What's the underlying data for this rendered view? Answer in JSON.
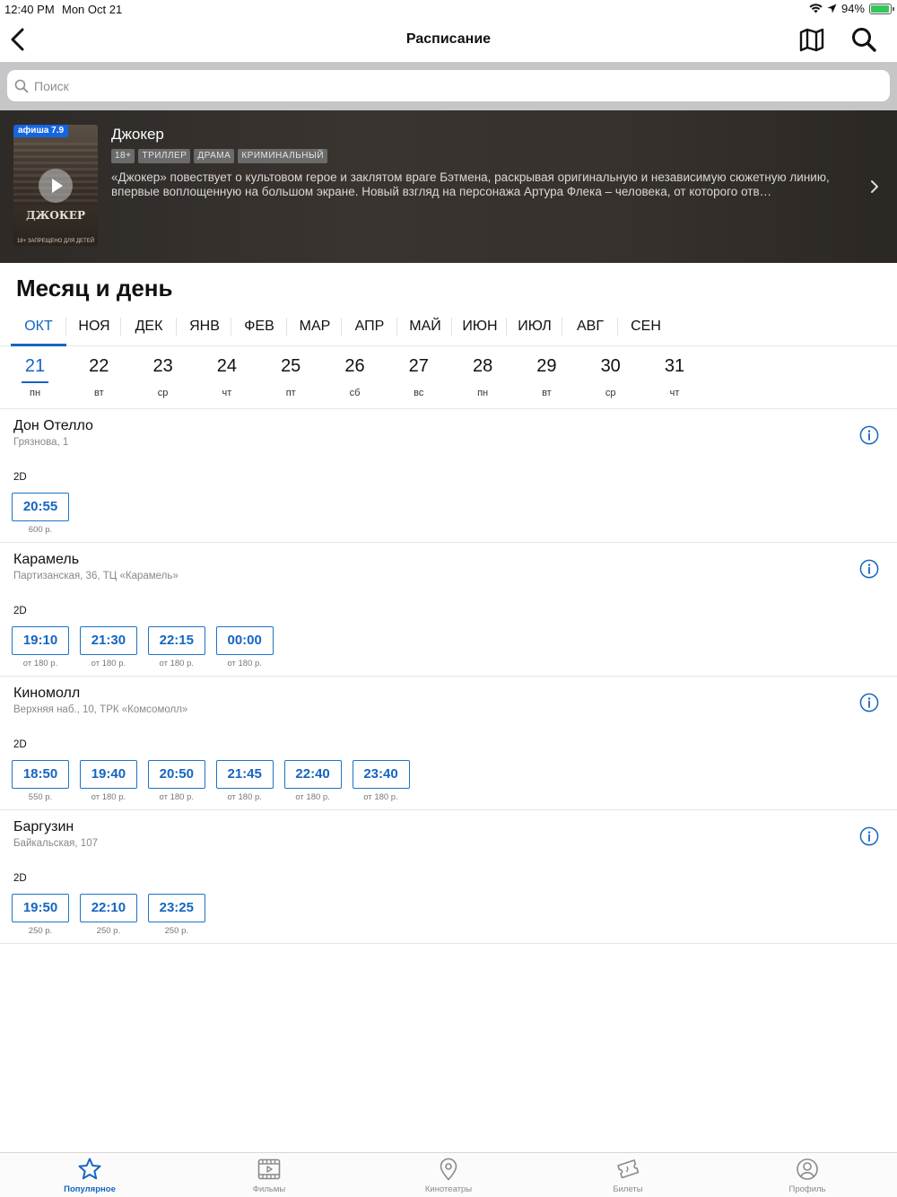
{
  "status": {
    "time": "12:40 PM",
    "date": "Mon Oct 21",
    "battery": "94%",
    "battery_level": 0.94
  },
  "nav": {
    "title": "Расписание",
    "back_icon": "chevron-left-icon",
    "map_icon": "map-icon",
    "search_icon": "search-icon"
  },
  "search": {
    "placeholder": "Поиск",
    "value": ""
  },
  "movie": {
    "badge": "афиша 7.9",
    "poster_title": "ДЖОКЕР",
    "poster_note": "18+ ЗАПРЕЩЕНО ДЛЯ ДЕТЕЙ",
    "title": "Джокер",
    "tags": [
      "18+",
      "ТРИЛЛЕР",
      "ДРАМА",
      "КРИМИНАЛЬНЫЙ"
    ],
    "description": "«Джокер» повествует о культовом герое и заклятом враге Бэтмена, раскрывая оригинальную и независимую сюжетную линию, впервые воплощенную на большом экране. Новый взгляд на персонажа Артура Флека – человека, от которого отв…"
  },
  "section_title": "Месяц и день",
  "months": [
    "ОКТ",
    "НОЯ",
    "ДЕК",
    "ЯНВ",
    "ФЕВ",
    "МАР",
    "АПР",
    "МАЙ",
    "ИЮН",
    "ИЮЛ",
    "АВГ",
    "СЕН"
  ],
  "selected_month": "ОКТ",
  "days": [
    {
      "num": "21",
      "wd": "пн"
    },
    {
      "num": "22",
      "wd": "вт"
    },
    {
      "num": "23",
      "wd": "ср"
    },
    {
      "num": "24",
      "wd": "чт"
    },
    {
      "num": "25",
      "wd": "пт"
    },
    {
      "num": "26",
      "wd": "сб"
    },
    {
      "num": "27",
      "wd": "вс"
    },
    {
      "num": "28",
      "wd": "пн"
    },
    {
      "num": "29",
      "wd": "вт"
    },
    {
      "num": "30",
      "wd": "ср"
    },
    {
      "num": "31",
      "wd": "чт"
    }
  ],
  "selected_day": "21",
  "cinemas": [
    {
      "name": "Дон Отелло",
      "address": "Грязнова, 1",
      "format": "2D",
      "sessions": [
        {
          "time": "20:55",
          "price": "600 р."
        }
      ]
    },
    {
      "name": "Карамель",
      "address": "Партизанская, 36, ТЦ «Карамель»",
      "format": "2D",
      "sessions": [
        {
          "time": "19:10",
          "price": "от 180 р."
        },
        {
          "time": "21:30",
          "price": "от 180 р."
        },
        {
          "time": "22:15",
          "price": "от 180 р."
        },
        {
          "time": "00:00",
          "price": "от 180 р."
        }
      ]
    },
    {
      "name": "Киномолл",
      "address": "Верхняя наб., 10, ТРК «Комсомолл»",
      "format": "2D",
      "sessions": [
        {
          "time": "18:50",
          "price": "550 р."
        },
        {
          "time": "19:40",
          "price": "от 180 р."
        },
        {
          "time": "20:50",
          "price": "от 180 р."
        },
        {
          "time": "21:45",
          "price": "от 180 р."
        },
        {
          "time": "22:40",
          "price": "от 180 р."
        },
        {
          "time": "23:40",
          "price": "от 180 р."
        }
      ]
    },
    {
      "name": "Баргузин",
      "address": "Байкальская, 107",
      "format": "2D",
      "sessions": [
        {
          "time": "19:50",
          "price": "250 р."
        },
        {
          "time": "22:10",
          "price": "250 р."
        },
        {
          "time": "23:25",
          "price": "250 р."
        }
      ]
    }
  ],
  "tabs": [
    {
      "label": "Популярное",
      "icon": "star-icon",
      "active": true
    },
    {
      "label": "Фильмы",
      "icon": "film-icon",
      "active": false
    },
    {
      "label": "Кинотеатры",
      "icon": "location-pin-icon",
      "active": false
    },
    {
      "label": "Билеты",
      "icon": "ticket-icon",
      "active": false
    },
    {
      "label": "Профиль",
      "icon": "profile-icon",
      "active": false
    }
  ],
  "colors": {
    "accent": "#1565c0",
    "banner_bg": "#36312c",
    "search_bg": "#c6c6c8",
    "battery": "#34c759"
  }
}
